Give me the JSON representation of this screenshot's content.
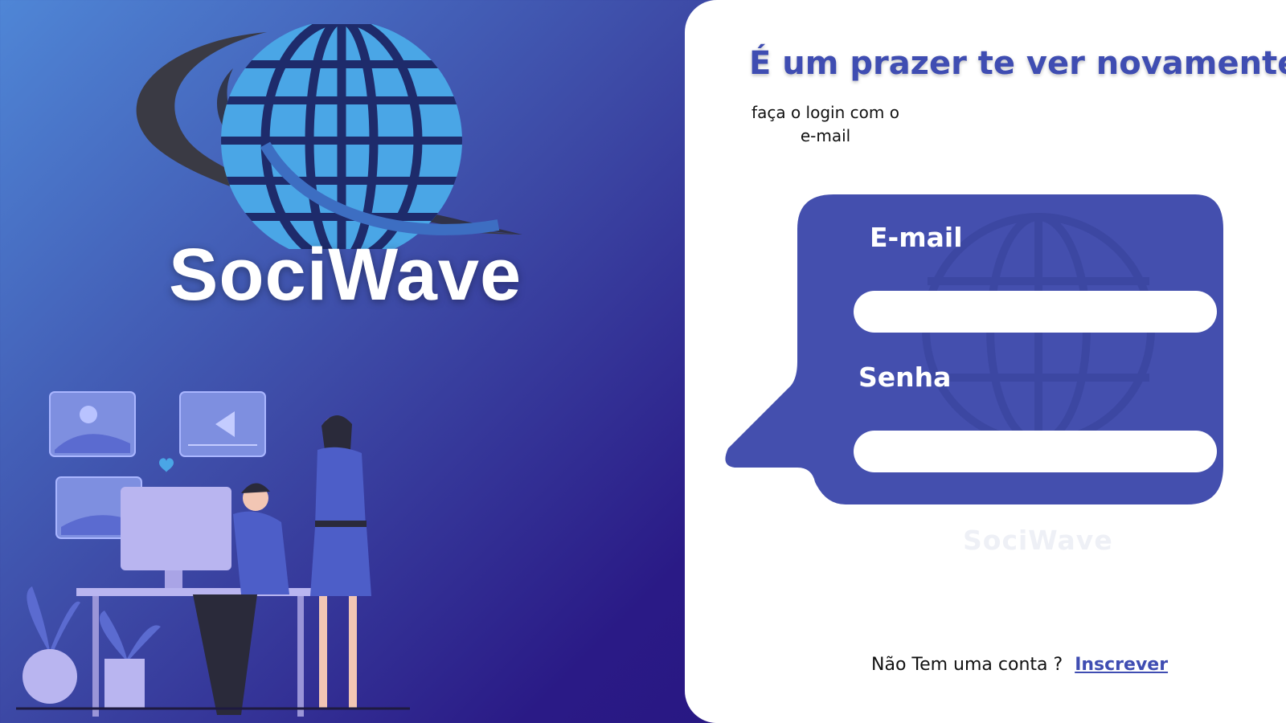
{
  "brand": {
    "name": "SociWave",
    "logo_icon": "globe-wave-icon",
    "colors": {
      "globe": "#4aa6e6",
      "swoosh": "#3a3a44"
    }
  },
  "illustration": {
    "icon": "people-media-workspace-illustration"
  },
  "login": {
    "title": "É um prazer te ver novamente",
    "subtitle": "faça o login com o e-mail",
    "email_label": "E-mail",
    "email_value": "",
    "email_placeholder": "",
    "password_label": "Senha",
    "password_value": "",
    "password_placeholder": "",
    "watermark": "SociWave",
    "signup_prompt": "Não Tem uma conta ?",
    "signup_link": "Inscrever"
  },
  "colors": {
    "accent": "#3f4db2",
    "bubble": "#444fae",
    "background_start": "#4f86d6",
    "background_end": "#23107a",
    "card": "#ffffff"
  }
}
